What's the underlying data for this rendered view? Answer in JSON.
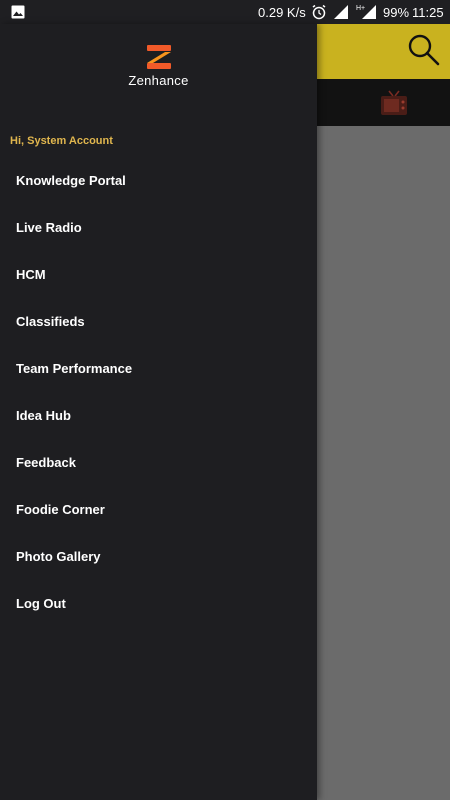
{
  "status_bar": {
    "net_speed": "0.29 K/s",
    "battery": "99%",
    "time": "11:25",
    "icons": [
      "image-icon",
      "alarm-icon",
      "signal-icon",
      "hplus-signal-icon"
    ]
  },
  "brand": {
    "name": "Zenhance",
    "logo_colors": [
      "#f15a29",
      "#f7941d"
    ]
  },
  "drawer": {
    "greeting": "Hi, System Account",
    "items": [
      {
        "label": "Knowledge Portal"
      },
      {
        "label": "Live Radio"
      },
      {
        "label": "HCM"
      },
      {
        "label": "Classifieds"
      },
      {
        "label": "Team Performance"
      },
      {
        "label": "Idea Hub"
      },
      {
        "label": "Feedback"
      },
      {
        "label": "Foodie Corner"
      },
      {
        "label": "Photo Gallery"
      },
      {
        "label": "Log Out"
      }
    ]
  },
  "app": {
    "toolbar_color": "#c9b21f",
    "icons": [
      "search-icon",
      "tv-icon"
    ]
  }
}
